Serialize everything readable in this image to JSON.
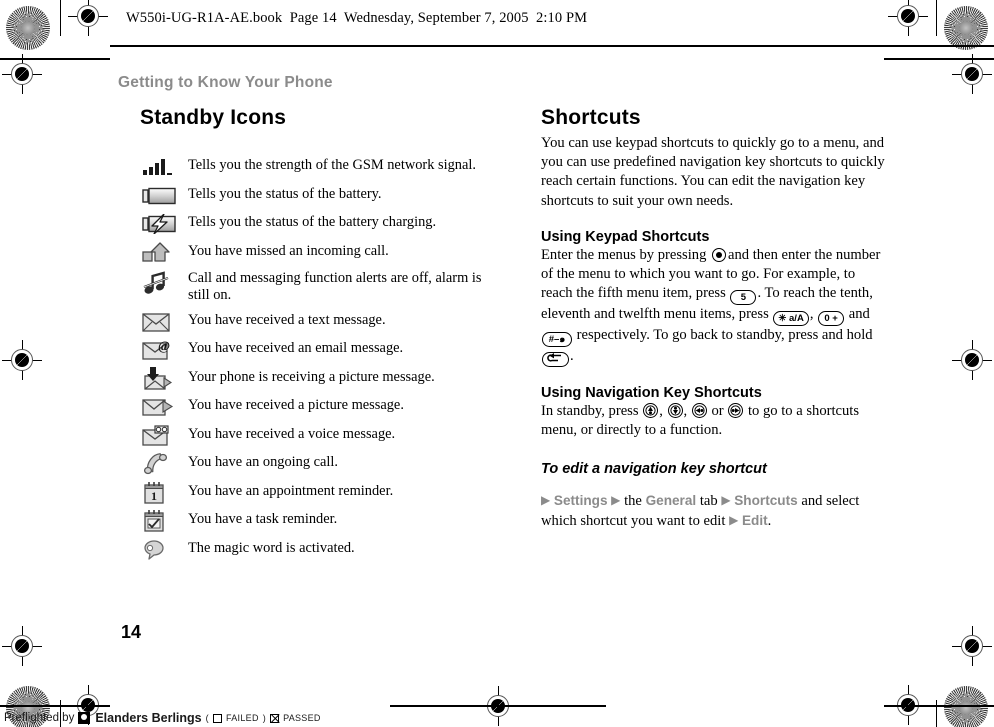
{
  "header": {
    "file_line": "W550i-UG-R1A-AE.book  Page 14  Wednesday, September 7, 2005  2:10 PM"
  },
  "running_head": "Getting to Know Your Phone",
  "page_number": "14",
  "left_column": {
    "title": "Standby Icons",
    "icons": [
      {
        "icon": "signal-strength-icon",
        "description": "Tells you the strength of the GSM network signal."
      },
      {
        "icon": "battery-icon",
        "description": "Tells you the status of the battery."
      },
      {
        "icon": "battery-charging-icon",
        "description": "Tells you the status of the battery charging."
      },
      {
        "icon": "missed-call-icon",
        "description": "You have missed an incoming call."
      },
      {
        "icon": "silent-mode-icon",
        "description": "Call and messaging function alerts are off, alarm is still on."
      },
      {
        "icon": "text-message-icon",
        "description": "You have received a text message."
      },
      {
        "icon": "email-message-icon",
        "description": "You have received an email message."
      },
      {
        "icon": "receiving-picture-message-icon",
        "description": "Your phone is receiving a picture message."
      },
      {
        "icon": "picture-message-icon",
        "description": "You have received a picture message."
      },
      {
        "icon": "voice-message-icon",
        "description": "You have received a voice message."
      },
      {
        "icon": "ongoing-call-icon",
        "description": "You have an ongoing call."
      },
      {
        "icon": "appointment-reminder-icon",
        "description": "You have an appointment reminder."
      },
      {
        "icon": "task-reminder-icon",
        "description": "You have a task reminder."
      },
      {
        "icon": "magic-word-icon",
        "description": "The magic word is activated."
      }
    ]
  },
  "right_column": {
    "title": "Shortcuts",
    "intro": "You can use keypad shortcuts to quickly go to a menu, and you can use predefined navigation key shortcuts to quickly reach certain functions. You can edit the navigation key shortcuts to suit your own needs.",
    "keypad_section": {
      "title": "Using Keypad Shortcuts",
      "text_1": "Enter the menus by pressing",
      "text_2": "and then enter the number of the menu to which you want to go. For example, to reach the fifth menu item, press",
      "key_five": "5",
      "text_3": ". To reach the tenth, eleventh and twelfth menu items, press",
      "key_star": "✳ a/A",
      "text_4": ",",
      "key_zero": "0 +",
      "text_5": "and",
      "key_hash": "#–๑",
      "text_6": "respectively. To go back to standby, press and hold",
      "key_back": "back-key",
      "text_7": "."
    },
    "navigation_section": {
      "title": "Using Navigation Key Shortcuts",
      "text_1": "In standby, press",
      "keys": [
        "nav-up-key",
        "nav-down-key",
        "nav-left-key",
        "nav-right-key"
      ],
      "text_2": "or",
      "text_3": "to go to a shortcuts menu, or directly to a function."
    },
    "procedure": {
      "title": "To edit a navigation key shortcut",
      "arrow": "▶",
      "term_settings": "Settings",
      "connector_1": "the",
      "term_general": "General",
      "connector_2": "tab",
      "term_shortcuts": "Shortcuts",
      "connector_3": "and select which shortcut you want to edit",
      "term_edit": "Edit",
      "period": "."
    }
  },
  "footer": {
    "preflight_label": "Preflighted by",
    "brand": "Elanders Berlings",
    "open_paren": "(",
    "failed_label": "FAILED",
    "close_paren": ")",
    "passed_label": "PASSED"
  },
  "colors": {
    "path_term": "#8b8b8b",
    "running_head": "#8b8b8b",
    "text": "#000000",
    "icon_gray": "#9a9a9a"
  }
}
